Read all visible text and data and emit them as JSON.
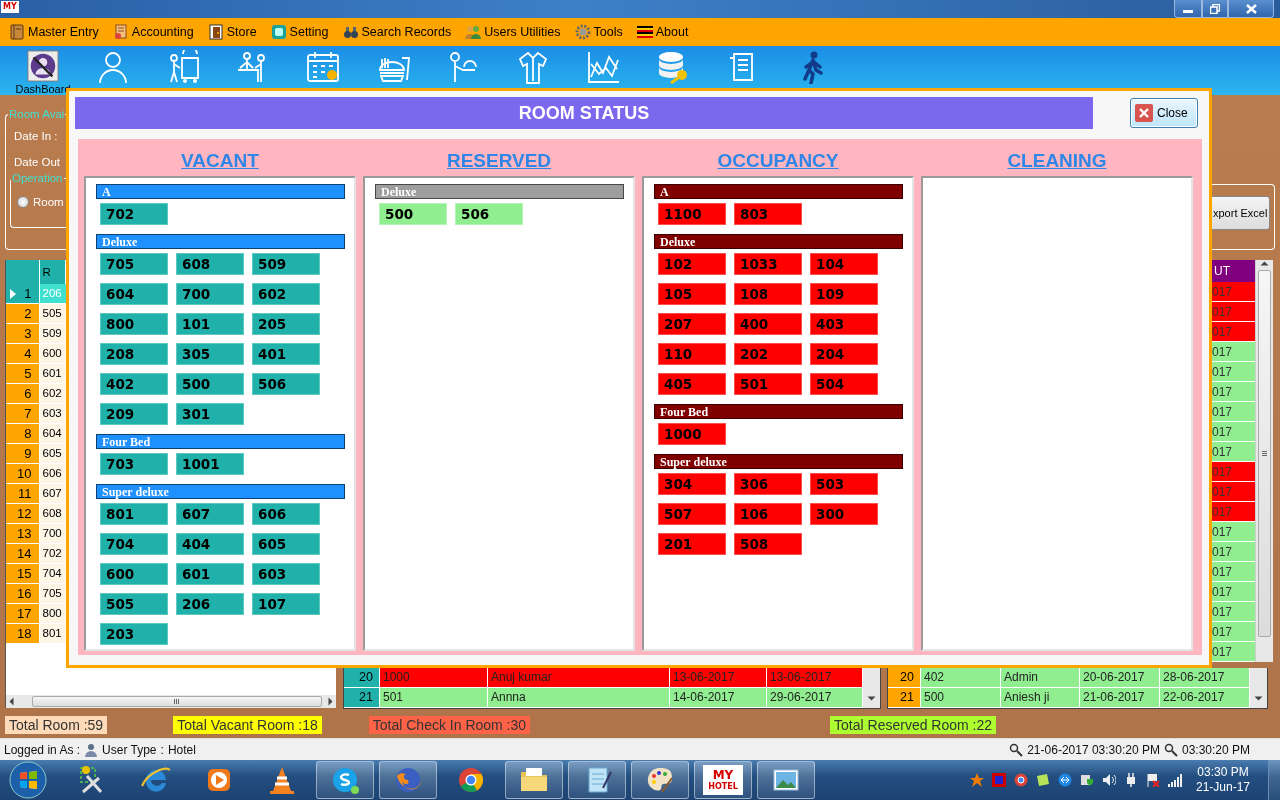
{
  "window": {
    "logo": "MY"
  },
  "menu": [
    {
      "label": "Master Entry"
    },
    {
      "label": "Accounting"
    },
    {
      "label": "Store"
    },
    {
      "label": "Setting"
    },
    {
      "label": "Search Records"
    },
    {
      "label": "Users Utilities"
    },
    {
      "label": "Tools"
    },
    {
      "label": "About"
    }
  ],
  "toolbar": [
    {
      "label": "DashBoard"
    }
  ],
  "room_availability": {
    "legend": "Room Avai",
    "date_in": "Date In :",
    "date_out": "Date Out",
    "operation_legend": "Operation",
    "radio": {
      "label": "Room",
      "selected": false
    }
  },
  "left_grid": {
    "header": "R",
    "rows": [
      {
        "no": "1",
        "room": "206",
        "selected": true
      },
      {
        "no": "2",
        "room": "505",
        "selected": false
      },
      {
        "no": "3",
        "room": "509",
        "selected": false
      },
      {
        "no": "4",
        "room": "600",
        "selected": false
      },
      {
        "no": "5",
        "room": "601",
        "selected": false
      },
      {
        "no": "6",
        "room": "602",
        "selected": false
      },
      {
        "no": "7",
        "room": "603",
        "selected": false
      },
      {
        "no": "8",
        "room": "604",
        "selected": false
      },
      {
        "no": "9",
        "room": "605",
        "selected": false
      },
      {
        "no": "10",
        "room": "606",
        "selected": false
      },
      {
        "no": "11",
        "room": "607",
        "selected": false
      },
      {
        "no": "12",
        "room": "608",
        "selected": false
      },
      {
        "no": "13",
        "room": "700",
        "selected": false
      },
      {
        "no": "14",
        "room": "702",
        "selected": false
      },
      {
        "no": "15",
        "room": "704",
        "selected": false
      },
      {
        "no": "16",
        "room": "705",
        "selected": false
      },
      {
        "no": "17",
        "room": "800",
        "selected": false
      },
      {
        "no": "18",
        "room": "801",
        "selected": false
      }
    ]
  },
  "export_button": "xport Excel",
  "right_strip": {
    "header": "UT",
    "rows": [
      {
        "text": "017",
        "color": "#ff0000"
      },
      {
        "text": "017",
        "color": "#ff0000"
      },
      {
        "text": "017",
        "color": "#ff0000"
      },
      {
        "text": "017",
        "color": "#90ee90"
      },
      {
        "text": "017",
        "color": "#90ee90"
      },
      {
        "text": "017",
        "color": "#90ee90"
      },
      {
        "text": "017",
        "color": "#90ee90"
      },
      {
        "text": "017",
        "color": "#90ee90"
      },
      {
        "text": "017",
        "color": "#90ee90"
      },
      {
        "text": "017",
        "color": "#ff0000"
      },
      {
        "text": "017",
        "color": "#ff0000"
      },
      {
        "text": "017",
        "color": "#ff0000"
      },
      {
        "text": "017",
        "color": "#90ee90"
      },
      {
        "text": "017",
        "color": "#90ee90"
      },
      {
        "text": "017",
        "color": "#90ee90"
      },
      {
        "text": "017",
        "color": "#90ee90"
      },
      {
        "text": "017",
        "color": "#90ee90"
      },
      {
        "text": "017",
        "color": "#90ee90"
      },
      {
        "text": "017",
        "color": "#90ee90"
      }
    ]
  },
  "bottom_middle_rows": [
    {
      "no": "20",
      "room": "1000",
      "name": "Anuj kumar",
      "date_in": "13-06-2017",
      "date_out": "13-06-2017",
      "color": "#ff0000"
    },
    {
      "no": "21",
      "room": "501",
      "name": "Annna",
      "date_in": "14-06-2017",
      "date_out": "29-06-2017",
      "color": "#90ee90"
    }
  ],
  "bottom_right_rows": [
    {
      "no": "20",
      "room": "402",
      "name": "Admin",
      "date_in": "20-06-2017",
      "date_out": "28-06-2017",
      "color": "#90ee90"
    },
    {
      "no": "21",
      "room": "500",
      "name": "Aniesh ji",
      "date_in": "21-06-2017",
      "date_out": "22-06-2017",
      "color": "#90ee90"
    }
  ],
  "totals": [
    {
      "text": "Total Room :59",
      "color": "#ffdab9"
    },
    {
      "text": "Total Vacant Room :18",
      "color": "#ffff00"
    },
    {
      "text": "Total Check In Room :30",
      "color": "#ff6347"
    },
    {
      "text": "Total Reserved Room :22",
      "color": "#adff2f"
    }
  ],
  "status_bar": {
    "logged_in": "Logged in As :",
    "user_type": "User Type",
    "separator": ":",
    "user": "Hotel",
    "datetime": "21-06-2017 03:30:20 PM",
    "time": "03:30:20 PM"
  },
  "taskbar": {
    "app_label": "MY",
    "app_sublabel": "HOTEL",
    "time": "03:30 PM",
    "date": "21-Jun-17"
  },
  "dialog": {
    "title": "ROOM STATUS",
    "close": "Close",
    "columns": [
      {
        "kind": "vacant",
        "title": "VACANT",
        "groups": [
          {
            "name": "A",
            "rooms": [
              "702"
            ]
          },
          {
            "name": "Deluxe",
            "rooms": [
              "705",
              "608",
              "509",
              "604",
              "700",
              "602",
              "800",
              "101",
              "205",
              "208",
              "305",
              "401",
              "402",
              "500",
              "506",
              "209",
              "301"
            ]
          },
          {
            "name": "Four Bed",
            "rooms": [
              "703",
              "1001"
            ]
          },
          {
            "name": "Super deluxe",
            "rooms": [
              "801",
              "607",
              "606",
              "704",
              "404",
              "605",
              "600",
              "601",
              "603",
              "505",
              "206",
              "107",
              "203"
            ]
          }
        ]
      },
      {
        "kind": "reserved",
        "title": "RESERVED",
        "groups": [
          {
            "name": "Deluxe",
            "rooms": [
              "500",
              "506"
            ]
          }
        ]
      },
      {
        "kind": "occupancy",
        "title": "OCCUPANCY",
        "groups": [
          {
            "name": "A",
            "rooms": [
              "1100",
              "803"
            ]
          },
          {
            "name": "Deluxe",
            "rooms": [
              "102",
              "1033",
              "104",
              "105",
              "108",
              "109",
              "207",
              "400",
              "403",
              "110",
              "202",
              "204",
              "405",
              "501",
              "504"
            ]
          },
          {
            "name": "Four Bed",
            "rooms": [
              "1000"
            ]
          },
          {
            "name": "Super deluxe",
            "rooms": [
              "304",
              "306",
              "503",
              "507",
              "106",
              "300",
              "201",
              "508"
            ]
          }
        ]
      },
      {
        "kind": "cleaning",
        "title": "CLEANING"
      }
    ]
  }
}
